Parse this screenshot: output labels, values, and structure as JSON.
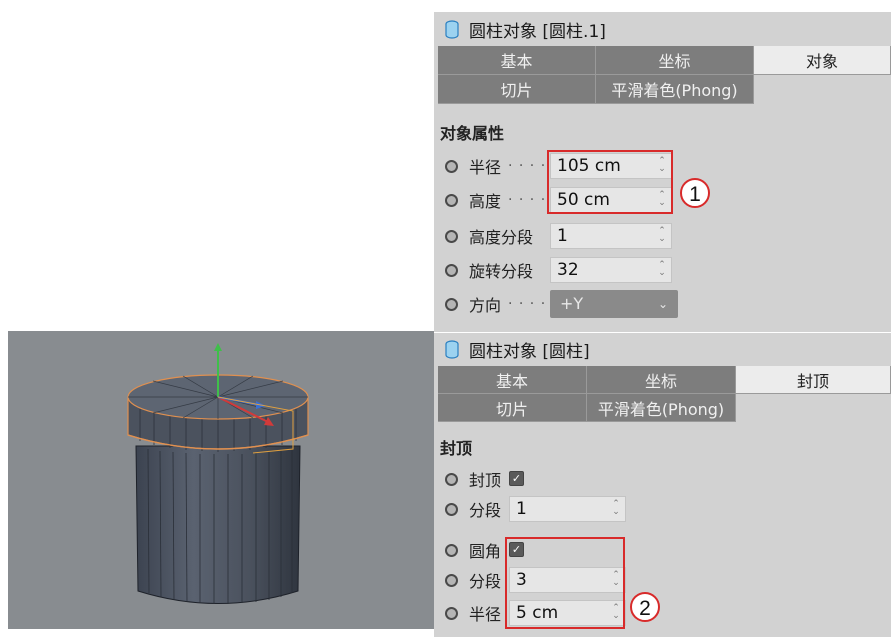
{
  "top_panel": {
    "title": "圆柱对象 [圆柱.1]",
    "tabs": [
      "基本",
      "坐标",
      "对象",
      "切片",
      "平滑着色(Phong)"
    ],
    "active_tab": "对象",
    "section": "对象属性",
    "rows": [
      {
        "label": "半径",
        "value": "105 cm"
      },
      {
        "label": "高度",
        "value": "50 cm"
      },
      {
        "label": "高度分段",
        "value": "1"
      },
      {
        "label": "旋转分段",
        "value": "32"
      },
      {
        "label": "方向",
        "value": "+Y"
      }
    ],
    "callout": "1"
  },
  "bottom_panel": {
    "title": "圆柱对象 [圆柱]",
    "tabs": [
      "基本",
      "坐标",
      "封顶",
      "切片",
      "平滑着色(Phong)"
    ],
    "active_tab": "封顶",
    "section": "封顶",
    "rows": [
      {
        "label": "封顶",
        "checked": true
      },
      {
        "label": "分段",
        "value": "1"
      },
      {
        "label": "圆角",
        "checked": true
      },
      {
        "label": "分段",
        "value": "3"
      },
      {
        "label": "半径",
        "value": "5 cm"
      }
    ],
    "callout": "2"
  },
  "colors": {
    "panel_bg": "#d2d2d2",
    "tab_bg": "#7d7d7d",
    "tab_active_bg": "#ececec",
    "highlight_red": "#d82a2a",
    "viewport_bg": "#888c90"
  },
  "icons": {
    "object": "cylinder-icon",
    "radio": "radio-circle-icon",
    "spinner": "spinner-arrows-icon",
    "dropdown": "chevron-down-icon",
    "checkbox": "checkmark-icon"
  }
}
